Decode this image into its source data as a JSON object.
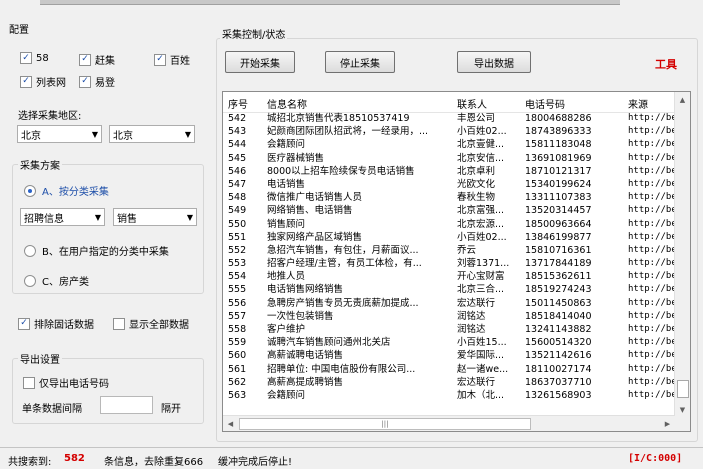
{
  "config": {
    "title": "配置",
    "sources": [
      {
        "label": "58",
        "checked": true
      },
      {
        "label": "赶集",
        "checked": true
      },
      {
        "label": "百姓",
        "checked": true
      },
      {
        "label": "列表网",
        "checked": true
      },
      {
        "label": "易登",
        "checked": true
      }
    ],
    "region_label": "选择采集地区:",
    "region_province": "北京",
    "region_city": "北京",
    "plan": {
      "title": "采集方案",
      "option_a": "A、按分类采集",
      "category_main": "招聘信息",
      "category_sub": "销售",
      "option_b": "B、在用户指定的分类中采集",
      "option_c": "C、房产类"
    },
    "exclude_landline": "排除固话数据",
    "show_all": "显示全部数据",
    "export": {
      "title": "导出设置",
      "phone_only": "仅导出电话号码",
      "interval_label": "单条数据间隔",
      "interval_unit": "隔开"
    }
  },
  "control": {
    "title": "采集控制/状态",
    "start": "开始采集",
    "stop": "停止采集",
    "export": "导出数据",
    "tools": "工具"
  },
  "grid": {
    "columns": [
      "序号",
      "信息名称",
      "联系人",
      "电话号码",
      "来源"
    ],
    "rows": [
      [
        "542",
        "城招北京销售代表18510537419",
        "丰恩公司",
        "18004688286",
        "http://be"
      ],
      [
        "543",
        "妃颜商团际团队招武将，一经录用，...",
        "小百姓02...",
        "18743896333",
        "http://be"
      ],
      [
        "544",
        "会籍顾问",
        "北京壹健...",
        "15811183048",
        "http://be"
      ],
      [
        "545",
        "医疗器械销售",
        "北京安信...",
        "13691081969",
        "http://be"
      ],
      [
        "546",
        "8000以上招车险续保专员电话销售",
        "北京卓利",
        "18710121317",
        "http://be"
      ],
      [
        "547",
        "电话销售",
        "光欧文化",
        "15340199624",
        "http://be"
      ],
      [
        "548",
        "微信推广电话销售人员",
        "春秋生物",
        "13311107383",
        "http://be"
      ],
      [
        "549",
        "网络销售、电话销售",
        "北京富强...",
        "13520314457",
        "http://be"
      ],
      [
        "550",
        "销售顾问",
        "北京宏源...",
        "18500963664",
        "http://be"
      ],
      [
        "551",
        "独家网络产品区域销售",
        "小百姓02...",
        "13846199877",
        "http://be"
      ],
      [
        "552",
        "急招汽车销售，有包住，月薪面议...",
        "乔云",
        "15810716361",
        "http://be"
      ],
      [
        "553",
        "招客户经理/主管，有员工体检，有...",
        "刘蓉1371...",
        "13717844189",
        "http://be"
      ],
      [
        "554",
        "地推人员",
        "开心宝财富",
        "18515362611",
        "http://be"
      ],
      [
        "555",
        "电话销售网络销售",
        "北京三合...",
        "18519274243",
        "http://be"
      ],
      [
        "556",
        "急聘房产销售专员无责底薪加提成...",
        "宏达联行",
        "15011450863",
        "http://be"
      ],
      [
        "557",
        "一次性包装销售",
        "润铭达",
        "18518414040",
        "http://be"
      ],
      [
        "558",
        "客户维护",
        "润铭达",
        "13241143882",
        "http://be"
      ],
      [
        "559",
        "诚聘汽车销售顾问通州北关店",
        "小百姓15...",
        "15600514320",
        "http://be"
      ],
      [
        "560",
        "高薪诚聘电话销售",
        "爱华国际...",
        "13521142616",
        "http://be"
      ],
      [
        "561",
        "招聘单位: 中国电信股份有限公司...",
        "赵一诸we...",
        "18110027174",
        "http://be"
      ],
      [
        "562",
        "高薪高提成聘销售",
        "宏达联行",
        "18637037710",
        "http://be"
      ],
      [
        "563",
        "会籍顾问",
        "加木（北...",
        "13261568903",
        "http://be"
      ]
    ]
  },
  "status": {
    "found_label": "共搜索到:",
    "found_count": "582",
    "dedupe_text": "条信息，去除重复666",
    "buffer_text": "缓冲完成后停止!",
    "code": "[I/C:000]"
  },
  "colors": {
    "accent_red": "#d40000"
  }
}
